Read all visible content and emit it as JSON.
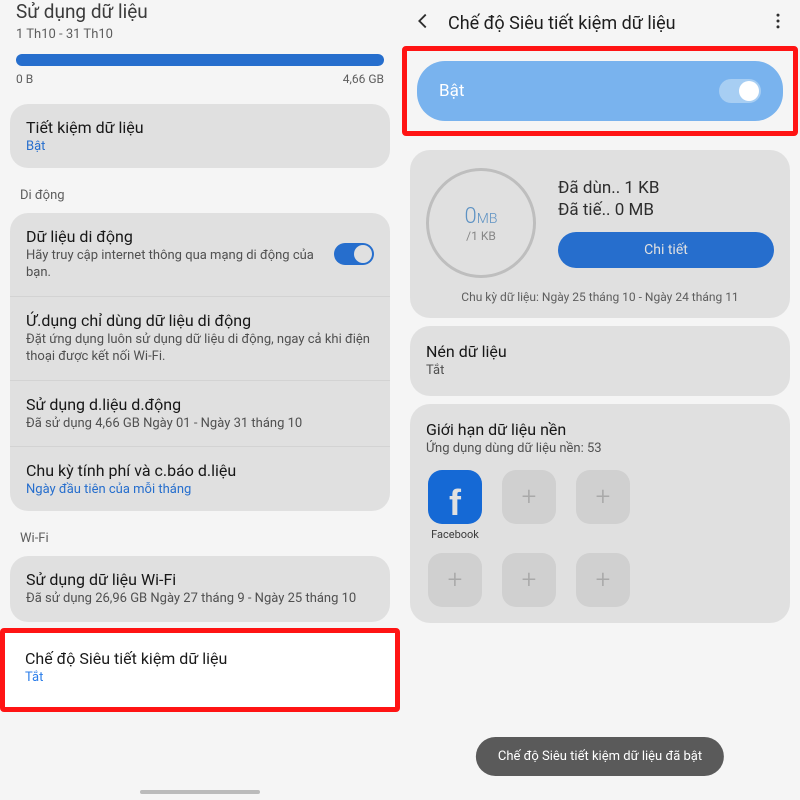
{
  "left": {
    "header_title": "Sử dụng dữ liệu",
    "date_range": "1 Th10 - 31 Th10",
    "progress_min": "0 B",
    "progress_max": "4,66 GB",
    "save_data": {
      "title": "Tiết kiệm dữ liệu",
      "status": "Bật"
    },
    "section_mobile": "Di động",
    "mobile_data": {
      "title": "Dữ liệu di động",
      "sub": "Hãy truy cập internet thông qua mạng di động của bạn."
    },
    "mobile_only": {
      "title": "Ứ.dụng chỉ dùng dữ liệu di động",
      "sub": "Đặt ứng dụng luôn sử dụng dữ liệu di động, ngay cả khi điện thoại được kết nối Wi-Fi."
    },
    "usage": {
      "title": "Sử dụng d.liệu d.động",
      "sub": "Đã sử dụng 4,66 GB Ngày 01 - Ngày 31 tháng 10"
    },
    "cycle": {
      "title": "Chu kỳ tính phí và c.báo d.liệu",
      "sub": "Ngày đầu tiên của mỗi tháng"
    },
    "section_wifi": "Wi-Fi",
    "wifi_usage": {
      "title": "Sử dụng dữ liệu Wi-Fi",
      "sub": "Đã sử dụng 26,96 GB Ngày 27 tháng 9 - Ngày 25 tháng 10"
    },
    "ultra": {
      "title": "Chế độ Siêu tiết kiệm dữ liệu",
      "status": "Tắt"
    }
  },
  "right": {
    "header_title": "Chế độ Siêu tiết kiệm dữ liệu",
    "enable_label": "Bật",
    "circle_value": "0",
    "circle_unit": "MB",
    "circle_sub": "/1 KB",
    "used_label": "Đã dùn.. 1 KB",
    "saved_label": "Đã tiế.. 0 MB",
    "detail_btn": "Chi tiết",
    "cycle_text": "Chu kỳ dữ liệu: Ngày 25 tháng 10 - Ngày 24 tháng 11",
    "compress": {
      "title": "Nén dữ liệu",
      "status": "Tắt"
    },
    "limit": {
      "title": "Giới hạn dữ liệu nền",
      "sub": "Ứng dụng dùng dữ liệu nền: 53"
    },
    "apps": {
      "facebook": "Facebook"
    },
    "toast": "Chế độ Siêu tiết kiệm dữ liệu đã bật"
  }
}
